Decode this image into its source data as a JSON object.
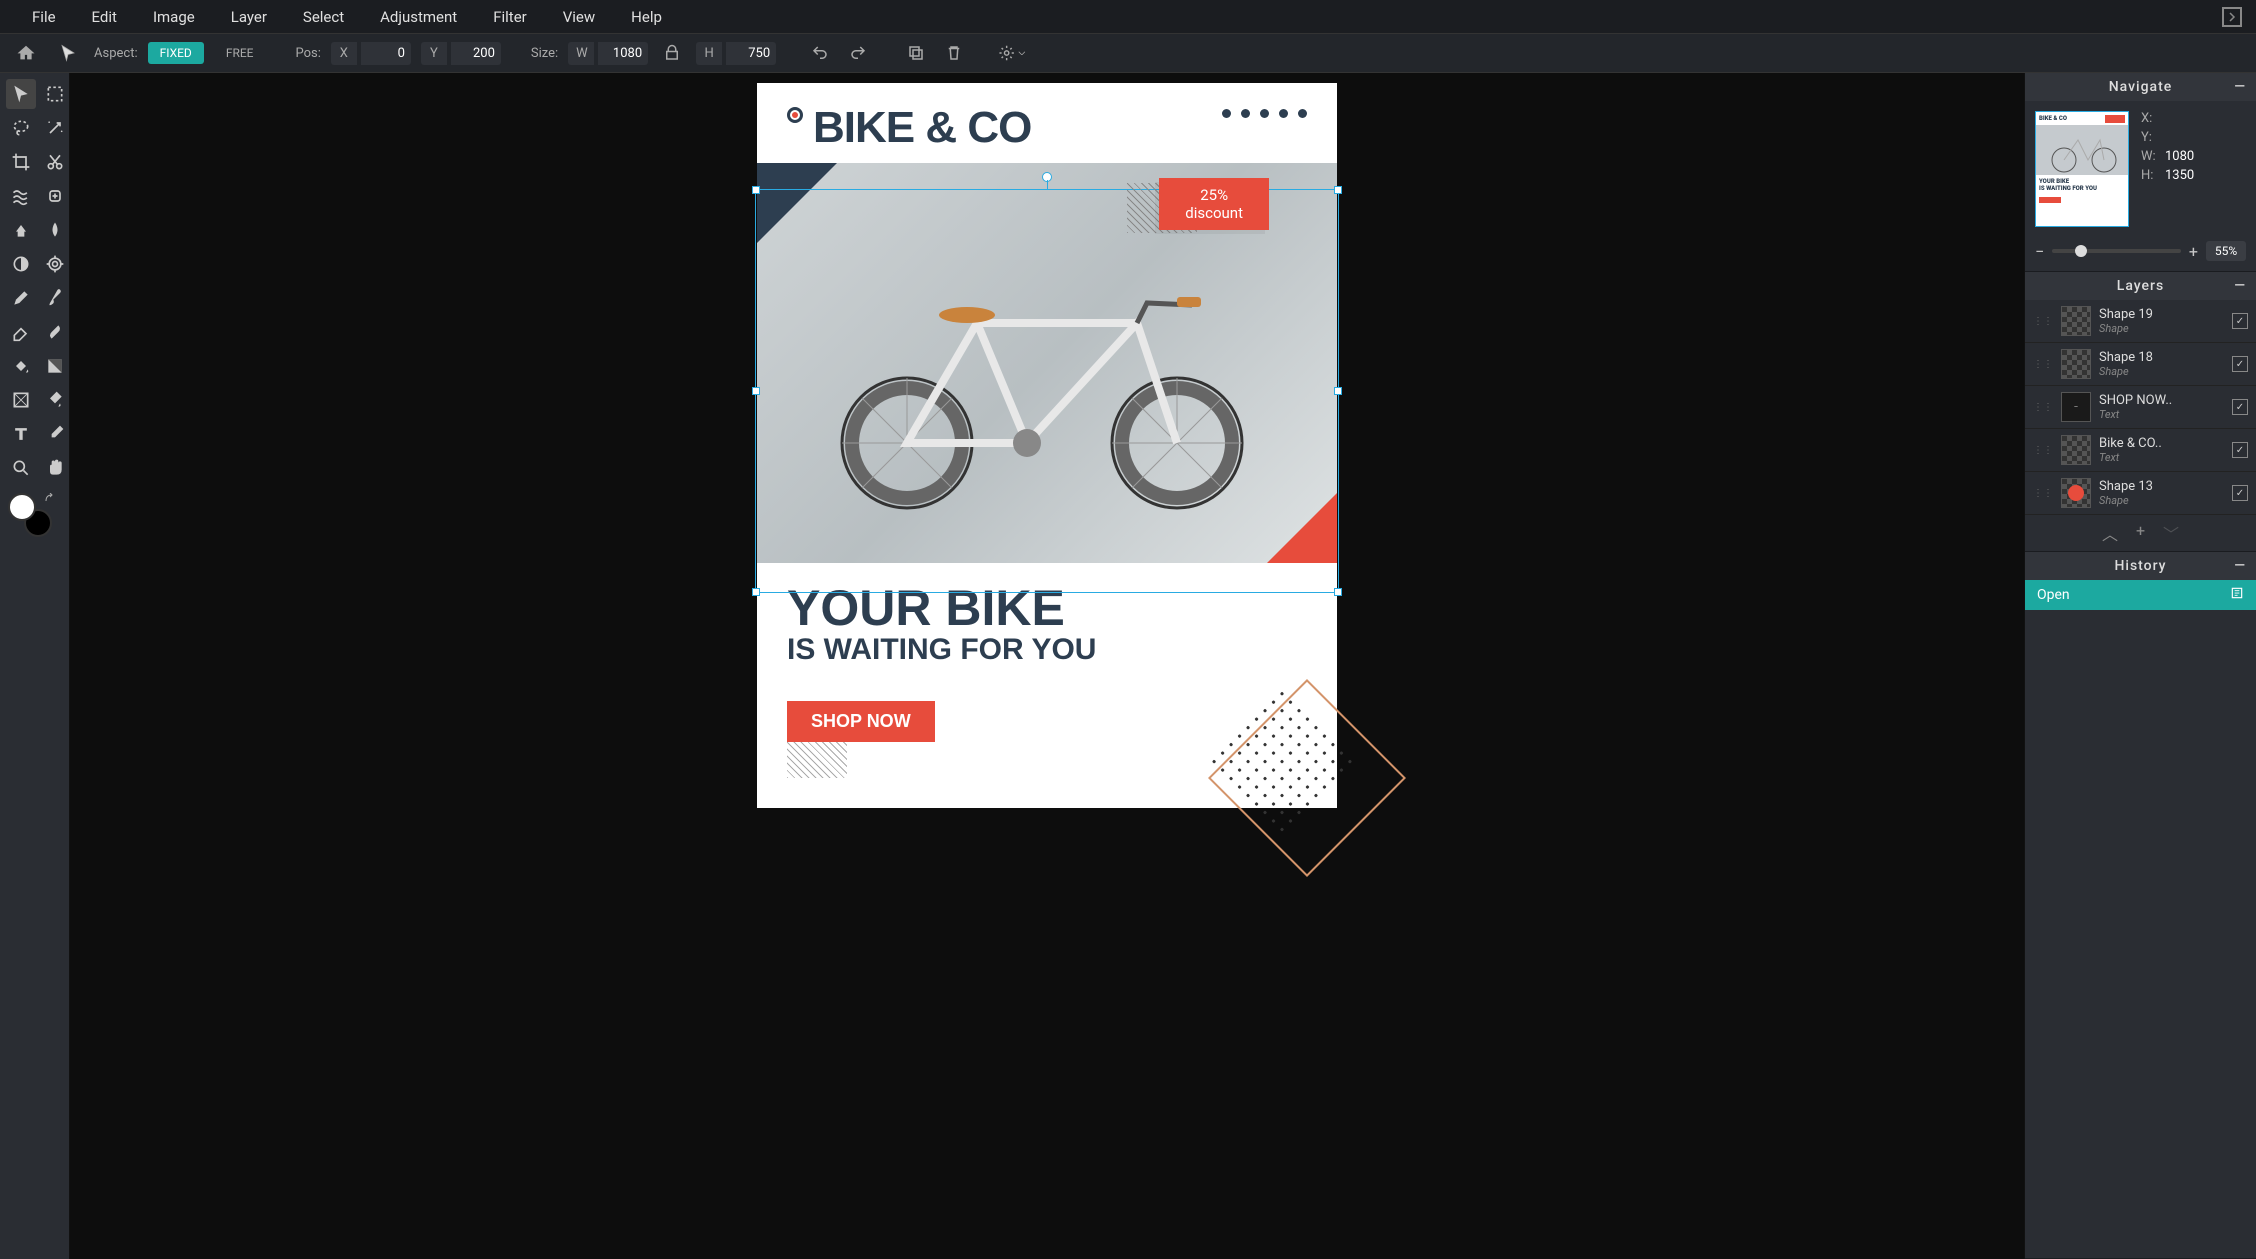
{
  "menu": {
    "items": [
      "File",
      "Edit",
      "Image",
      "Layer",
      "Select",
      "Adjustment",
      "Filter",
      "View",
      "Help"
    ]
  },
  "options": {
    "aspect_label": "Aspect:",
    "fixed": "FIXED",
    "free": "FREE",
    "pos_label": "Pos:",
    "x_label": "X",
    "x_value": "0",
    "y_label": "Y",
    "y_value": "200",
    "size_label": "Size:",
    "w_label": "W",
    "w_value": "1080",
    "h_label": "H",
    "h_value": "750"
  },
  "canvas_content": {
    "brand": "BIKE & CO",
    "discount_line1": "25%",
    "discount_line2": "discount",
    "headline": "YOUR BIKE",
    "subhead": "IS WAITING FOR YOU",
    "shop_btn": "SHOP NOW"
  },
  "navigate": {
    "title": "Navigate",
    "x_label": "X:",
    "x_value": "",
    "y_label": "Y:",
    "y_value": "",
    "w_label": "W:",
    "w_value": "1080",
    "h_label": "H:",
    "h_value": "1350",
    "zoom_value": "55%"
  },
  "layers_panel": {
    "title": "Layers",
    "items": [
      {
        "name": "Shape 19",
        "type": "Shape",
        "thumb": "checker"
      },
      {
        "name": "Shape 18",
        "type": "Shape",
        "thumb": "checker"
      },
      {
        "name": "SHOP NOW..",
        "type": "Text",
        "thumb": "text"
      },
      {
        "name": "Bike & CO..",
        "type": "Text",
        "thumb": "checker"
      },
      {
        "name": "Shape 13",
        "type": "Shape",
        "thumb": "red-circle"
      }
    ]
  },
  "history": {
    "title": "History",
    "items": [
      {
        "label": "Open"
      }
    ]
  }
}
